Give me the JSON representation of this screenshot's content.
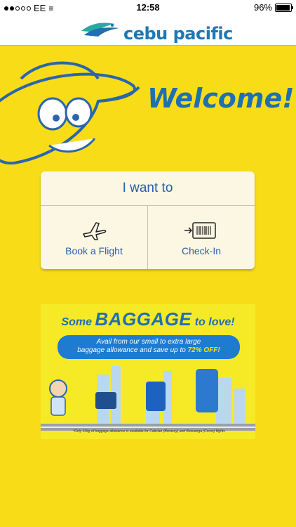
{
  "status": {
    "carrier": "EE",
    "time": "12:58",
    "battery": "96%",
    "battery_level": 0.96
  },
  "header": {
    "brand": "cebu pacific"
  },
  "welcome": {
    "text": "Welcome!"
  },
  "menu": {
    "title": "I want to",
    "items": [
      {
        "label": "Book a Flight",
        "icon": "airplane-icon"
      },
      {
        "label": "Check-In",
        "icon": "boarding-pass-icon"
      }
    ]
  },
  "promo": {
    "heading_pre": "Some",
    "heading_big": "BAGGAGE",
    "heading_post": "to love!",
    "line1": "Avail from our small to extra large",
    "line2": "baggage allowance and save up to",
    "discount": "72% OFF!",
    "footnote": "*Only 10kg of baggage allowance is available for Caticlan (Boracay) and Busuanga (Coron) flights"
  },
  "colors": {
    "background": "#f9dc18",
    "brand_blue": "#1f6fb2",
    "card": "#fbf7e3"
  }
}
